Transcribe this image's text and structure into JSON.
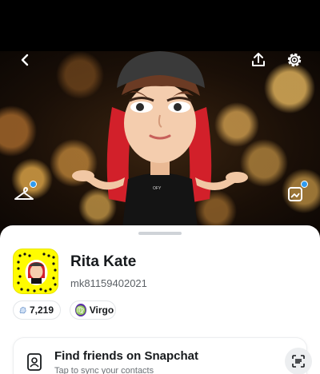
{
  "profile": {
    "display_name": "Rita Kate",
    "username": "mk81159402021"
  },
  "stats": {
    "snap_score": "7,219",
    "zodiac_sign": "Virgo"
  },
  "find_friends": {
    "title": "Find friends on Snapchat",
    "subtitle": "Tap to sync your contacts"
  },
  "colors": {
    "snapcode_yellow": "#fffc00",
    "notification_blue": "#2f9bf0",
    "zodiac_purple": "#5b2fa8"
  },
  "icons": {
    "back": "chevron-left-icon",
    "share": "share-icon",
    "settings": "gear-icon",
    "wardrobe": "hanger-icon",
    "photo": "photo-icon",
    "score": "star-cluster-icon",
    "zodiac": "virgo-icon",
    "contacts": "contacts-icon",
    "scan": "scan-icon"
  }
}
